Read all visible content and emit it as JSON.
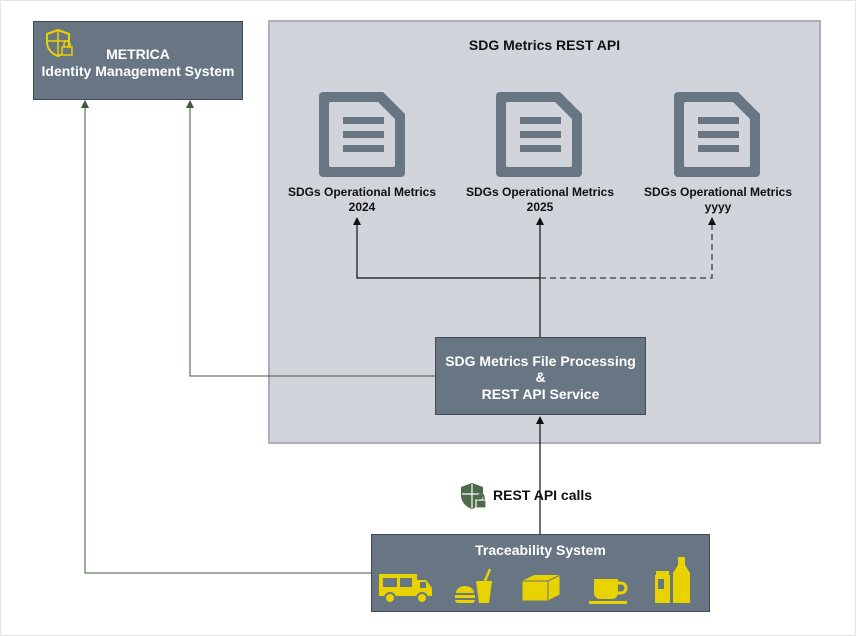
{
  "identity_system": {
    "line1": "METRICA",
    "line2": "Identity Management System",
    "icon": "shield-lock-icon"
  },
  "api_group": {
    "title": "SDG Metrics REST API",
    "documents": [
      {
        "line1": "SDGs Operational Metrics",
        "line2": "2024",
        "icon": "document-icon"
      },
      {
        "line1": "SDGs Operational Metrics",
        "line2": "2025",
        "icon": "document-icon"
      },
      {
        "line1": "SDGs Operational Metrics",
        "line2": "yyyy",
        "icon": "document-icon"
      }
    ]
  },
  "processing_service": {
    "line1": "SDG Metrics File Processing",
    "line2": "&",
    "line3": "REST API Service"
  },
  "api_calls": {
    "label": "REST API calls",
    "icon": "shield-lock-icon"
  },
  "traceability": {
    "title": "Traceability System",
    "icons": [
      "food-truck-icon",
      "burger-drink-icon",
      "box-icon",
      "coffee-cup-icon",
      "beverages-icon"
    ]
  },
  "colors": {
    "box_fill": "#687684",
    "panel_fill": "#d1d5db",
    "connector_green": "#3d5a3a",
    "icon_yellow": "#e8d200",
    "doc_icon_fill": "#687684"
  }
}
